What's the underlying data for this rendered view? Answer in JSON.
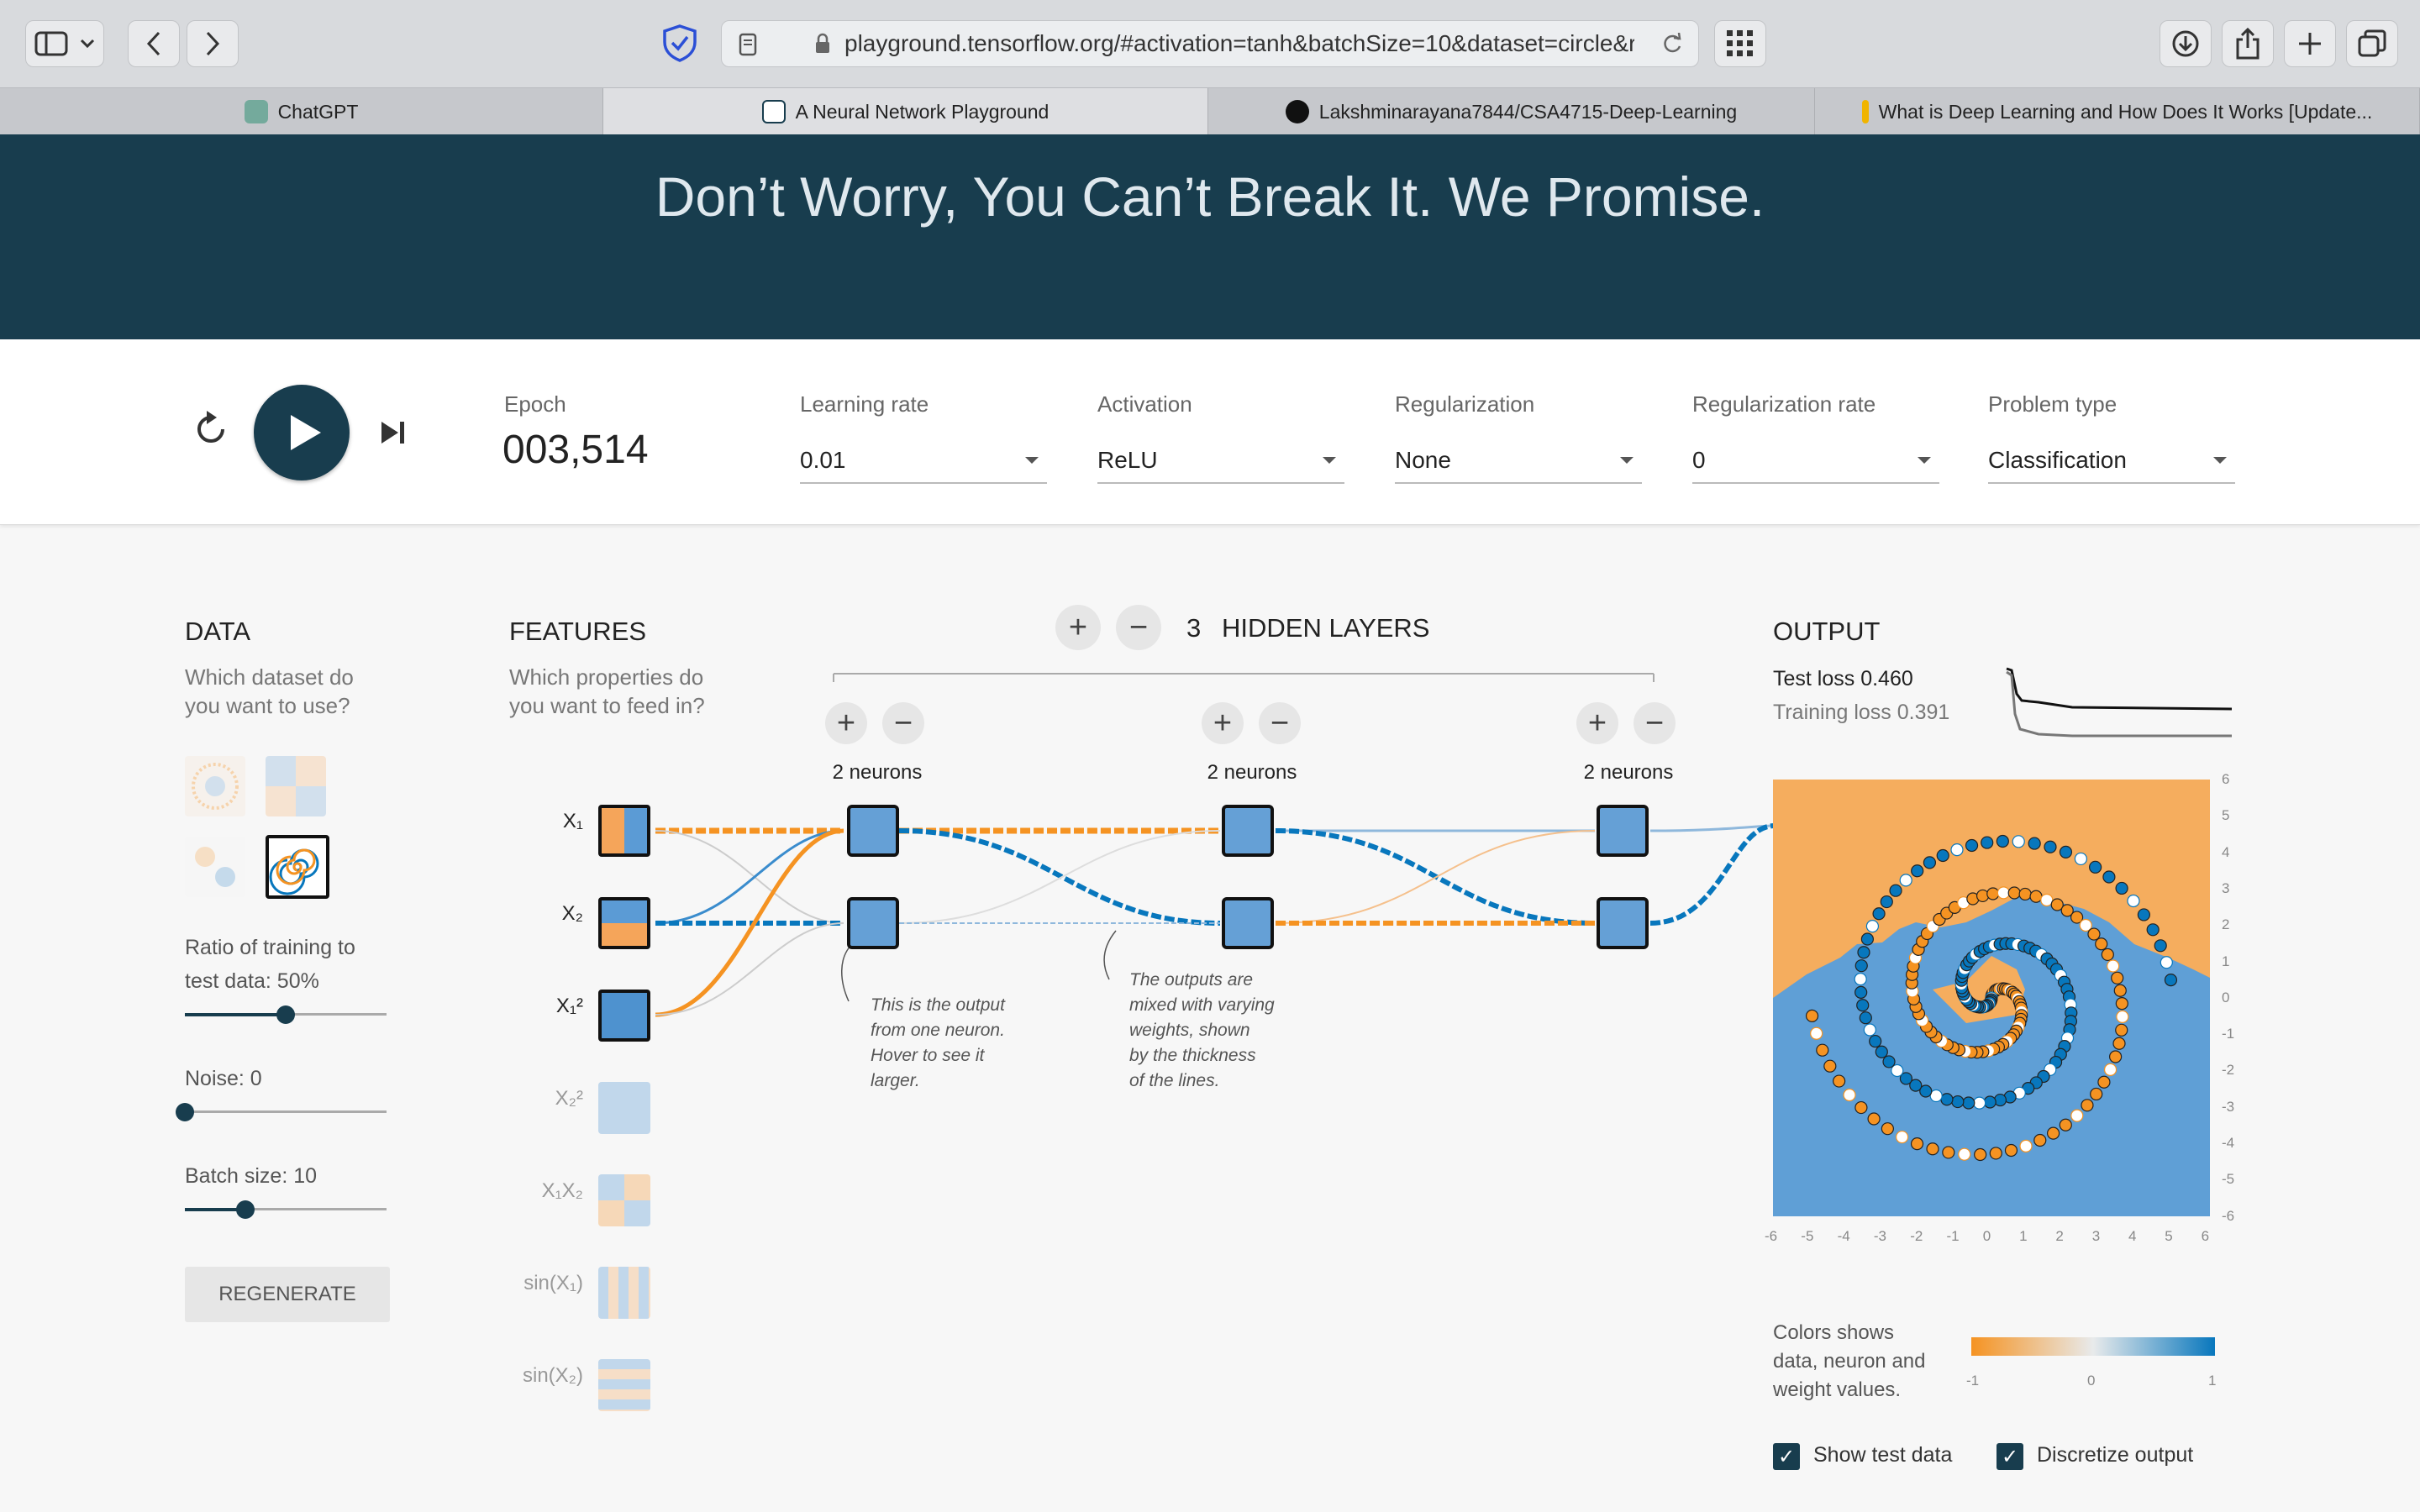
{
  "browser": {
    "url": "playground.tensorflow.org/#activation=tanh&batchSize=10&dataset=circle&re",
    "tabs": [
      {
        "label": "ChatGPT"
      },
      {
        "label": "A Neural Network Playground"
      },
      {
        "label": "Lakshminarayana7844/CSA4715-Deep-Learning"
      },
      {
        "label": "What is Deep Learning and How Does It Works [Update..."
      }
    ]
  },
  "header": {
    "tagline": "Don’t Worry, You Can’t Break It. We Promise."
  },
  "controls": {
    "epoch_label": "Epoch",
    "epoch_value": "003,514",
    "learning_rate": {
      "label": "Learning rate",
      "value": "0.01"
    },
    "activation": {
      "label": "Activation",
      "value": "ReLU"
    },
    "regularization": {
      "label": "Regularization",
      "value": "None"
    },
    "regularization_rate": {
      "label": "Regularization rate",
      "value": "0"
    },
    "problem_type": {
      "label": "Problem type",
      "value": "Classification"
    }
  },
  "data_panel": {
    "title": "DATA",
    "subtitle_1": "Which dataset do",
    "subtitle_2": "you want to use?",
    "ratio_label_1": "Ratio of training to",
    "ratio_label_2": "test data:  50%",
    "ratio_fraction": 0.5,
    "noise_label": "Noise:  0",
    "noise_fraction": 0,
    "batch_label": "Batch size:  10",
    "batch_fraction": 0.3,
    "regenerate": "REGENERATE",
    "selected_dataset": "spiral"
  },
  "features_panel": {
    "title": "FEATURES",
    "subtitle_1": "Which properties do",
    "subtitle_2": "you want to feed in?",
    "features": [
      {
        "label": "X₁",
        "active": true
      },
      {
        "label": "X₂",
        "active": true
      },
      {
        "label": "X₁²",
        "active": true
      },
      {
        "label": "X₂²",
        "active": false
      },
      {
        "label": "X₁X₂",
        "active": false
      },
      {
        "label": "sin(X₁)",
        "active": false
      },
      {
        "label": "sin(X₂)",
        "active": false
      }
    ]
  },
  "network": {
    "layer_count": "3",
    "title": "HIDDEN LAYERS",
    "layers": [
      {
        "label": "2 neurons"
      },
      {
        "label": "2 neurons"
      },
      {
        "label": "2 neurons"
      }
    ],
    "annotation_1": [
      "This is the output",
      "from one neuron.",
      "Hover to see it",
      "larger."
    ],
    "annotation_2": [
      "The outputs are",
      "mixed with varying",
      "weights, shown",
      "by the thickness",
      "of the lines."
    ]
  },
  "output_panel": {
    "title": "OUTPUT",
    "test_loss": "Test loss 0.460",
    "training_loss": "Training loss 0.391",
    "y_ticks": [
      "6",
      "5",
      "4",
      "3",
      "2",
      "1",
      "0",
      "-1",
      "-2",
      "-3",
      "-4",
      "-5",
      "-6"
    ],
    "x_ticks": [
      "-6",
      "-5",
      "-4",
      "-3",
      "-2",
      "-1",
      "0",
      "1",
      "2",
      "3",
      "4",
      "5",
      "6"
    ],
    "legend_text": [
      "Colors shows",
      "data, neuron and",
      "weight values."
    ],
    "legend_ticks": [
      "-1",
      "0",
      "1"
    ],
    "show_test_data": "Show test data",
    "discretize_output": "Discretize output"
  },
  "colors": {
    "orange": "#f59322",
    "blue": "#0877bd",
    "dark": "#183d4e"
  }
}
